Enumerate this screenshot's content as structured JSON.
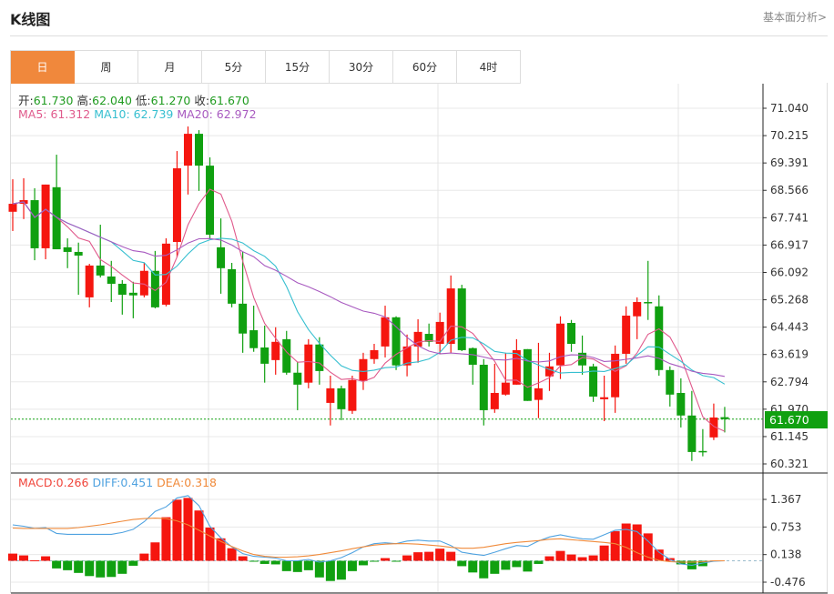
{
  "header": {
    "title": "K线图",
    "fundamental_link": "基本面分析>"
  },
  "tabs": [
    {
      "label": "日",
      "active": true
    },
    {
      "label": "周"
    },
    {
      "label": "月"
    },
    {
      "label": "5分"
    },
    {
      "label": "15分"
    },
    {
      "label": "30分"
    },
    {
      "label": "60分"
    },
    {
      "label": "4时"
    }
  ],
  "ohlc_info": {
    "open_label": "开:",
    "open": "61.730",
    "high_label": "高:",
    "high": "62.040",
    "low_label": "低:",
    "low": "61.270",
    "close_label": "收:",
    "close": "61.670"
  },
  "ma_info": {
    "ma5": "MA5: 61.312",
    "ma10": "MA10: 62.739",
    "ma20": "MA20: 62.972"
  },
  "macd_info": {
    "macd": "MACD:0.266",
    "diff": "DIFF:0.451",
    "dea": "DEA:0.318"
  },
  "last_price_label": "61.670",
  "colors": {
    "up": "#f5160f",
    "down": "#10a010",
    "ma5": "#e05a8c",
    "ma10": "#36bfd0",
    "ma20": "#a85ac0",
    "diff": "#4fa2e0",
    "dea": "#f08a3a",
    "active_tab": "#f0883c"
  },
  "chart_data": [
    {
      "type": "candlestick",
      "ylim": [
        60.321,
        71.04
      ],
      "y_ticks": [
        "71.040",
        "70.215",
        "69.391",
        "68.566",
        "67.741",
        "66.917",
        "66.092",
        "65.268",
        "64.443",
        "63.619",
        "62.794",
        "61.970",
        "61.145",
        "60.321"
      ],
      "last_price": 61.67,
      "ohlc": [
        [
          67.92,
          68.16,
          68.9,
          67.34
        ],
        [
          68.16,
          68.27,
          68.93,
          67.7
        ],
        [
          68.27,
          66.82,
          68.63,
          66.46
        ],
        [
          66.82,
          68.74,
          68.74,
          66.49
        ],
        [
          68.66,
          66.79,
          69.64,
          66.79
        ],
        [
          66.85,
          66.71,
          67.12,
          66.22
        ],
        [
          66.71,
          66.6,
          66.99,
          65.42
        ],
        [
          65.34,
          66.3,
          66.35,
          65.04
        ],
        [
          66.3,
          66.0,
          67.53,
          65.94
        ],
        [
          65.97,
          65.75,
          66.44,
          65.2
        ],
        [
          65.75,
          65.42,
          65.86,
          64.82
        ],
        [
          65.48,
          65.4,
          65.81,
          64.71
        ],
        [
          65.4,
          66.14,
          66.38,
          65.34
        ],
        [
          66.14,
          65.04,
          66.74,
          65.01
        ],
        [
          65.12,
          66.96,
          67.12,
          65.07
        ],
        [
          67.01,
          69.23,
          69.75,
          66.55
        ],
        [
          69.31,
          70.27,
          70.49,
          68.44
        ],
        [
          70.27,
          69.31,
          70.38,
          68.55
        ],
        [
          69.31,
          67.23,
          69.56,
          67.09
        ],
        [
          66.85,
          66.22,
          67.72,
          65.45
        ],
        [
          66.19,
          65.15,
          66.38,
          65.04
        ],
        [
          65.15,
          64.25,
          66.71,
          63.67
        ],
        [
          64.35,
          63.81,
          65.09,
          63.7
        ],
        [
          63.83,
          63.34,
          64.49,
          62.77
        ],
        [
          63.45,
          64.0,
          64.44,
          63.01
        ],
        [
          64.08,
          63.07,
          64.33,
          63.01
        ],
        [
          63.07,
          62.71,
          63.4,
          61.94
        ],
        [
          62.77,
          63.92,
          64.08,
          62.6
        ],
        [
          63.92,
          63.12,
          64.14,
          62.71
        ],
        [
          62.16,
          62.6,
          62.98,
          61.48
        ],
        [
          62.6,
          61.97,
          62.68,
          61.64
        ],
        [
          61.92,
          62.85,
          62.98,
          61.83
        ],
        [
          62.82,
          63.48,
          63.67,
          62.55
        ],
        [
          63.48,
          63.75,
          63.94,
          63.34
        ],
        [
          63.86,
          64.74,
          65.09,
          63.53
        ],
        [
          64.74,
          63.29,
          64.77,
          63.15
        ],
        [
          63.29,
          63.86,
          64.22,
          62.96
        ],
        [
          63.86,
          64.3,
          64.68,
          63.37
        ],
        [
          64.24,
          64.0,
          64.55,
          63.86
        ],
        [
          63.94,
          64.6,
          64.88,
          63.64
        ],
        [
          63.94,
          65.61,
          66.0,
          63.67
        ],
        [
          65.61,
          63.75,
          65.72,
          63.72
        ],
        [
          63.81,
          63.31,
          63.83,
          62.71
        ],
        [
          63.31,
          61.94,
          63.48,
          61.48
        ],
        [
          61.97,
          62.46,
          63.34,
          61.86
        ],
        [
          62.41,
          62.77,
          63.67,
          62.38
        ],
        [
          62.71,
          63.75,
          64.08,
          62.71
        ],
        [
          63.78,
          62.22,
          63.78,
          62.22
        ],
        [
          62.25,
          62.6,
          63.97,
          61.7
        ],
        [
          62.96,
          63.26,
          63.67,
          62.52
        ],
        [
          63.29,
          64.55,
          64.77,
          62.88
        ],
        [
          64.57,
          63.94,
          64.66,
          63.7
        ],
        [
          63.67,
          63.29,
          64.19,
          63.01
        ],
        [
          63.26,
          62.35,
          63.34,
          62.19
        ],
        [
          62.27,
          62.33,
          62.98,
          61.61
        ],
        [
          62.33,
          63.64,
          63.89,
          61.86
        ],
        [
          63.64,
          64.79,
          65.07,
          63.34
        ],
        [
          64.77,
          65.2,
          65.34,
          64.08
        ],
        [
          65.2,
          65.18,
          66.44,
          64.66
        ],
        [
          65.07,
          63.15,
          65.4,
          62.98
        ],
        [
          63.15,
          62.41,
          63.26,
          62.05
        ],
        [
          62.46,
          61.78,
          62.9,
          61.42
        ],
        [
          61.78,
          60.68,
          62.52,
          60.41
        ],
        [
          60.71,
          60.68,
          61.37,
          60.55
        ],
        [
          61.12,
          61.72,
          62.14,
          61.04
        ],
        [
          61.73,
          61.67,
          62.04,
          61.27
        ]
      ]
    },
    {
      "type": "bar+line",
      "ylim": [
        -0.476,
        1.367
      ],
      "y_ticks": [
        "1.367",
        "0.753",
        "0.138",
        "-0.476"
      ],
      "macd_hist": [
        0.16,
        0.12,
        0.01,
        0.1,
        -0.17,
        -0.21,
        -0.27,
        -0.34,
        -0.37,
        -0.36,
        -0.29,
        -0.11,
        0.16,
        0.41,
        0.97,
        1.36,
        1.4,
        1.12,
        0.74,
        0.5,
        0.28,
        0.1,
        -0.01,
        -0.07,
        -0.08,
        -0.23,
        -0.25,
        -0.21,
        -0.37,
        -0.45,
        -0.42,
        -0.23,
        -0.1,
        -0.01,
        0.06,
        -0.02,
        0.12,
        0.19,
        0.2,
        0.27,
        0.2,
        -0.12,
        -0.26,
        -0.39,
        -0.29,
        -0.2,
        -0.14,
        -0.24,
        -0.07,
        0.1,
        0.22,
        0.14,
        0.08,
        0.12,
        0.34,
        0.66,
        0.83,
        0.81,
        0.61,
        0.25,
        0.06,
        -0.08,
        -0.19,
        -0.12,
        0,
        0
      ],
      "diff": [
        0.8,
        0.77,
        0.72,
        0.74,
        0.61,
        0.59,
        0.59,
        0.59,
        0.59,
        0.59,
        0.63,
        0.7,
        0.87,
        1.1,
        1.2,
        1.4,
        1.45,
        1.23,
        0.77,
        0.51,
        0.31,
        0.16,
        0.1,
        0.08,
        0.06,
        0.0,
        0.0,
        0.03,
        -0.03,
        0.0,
        0.07,
        0.18,
        0.31,
        0.38,
        0.4,
        0.38,
        0.44,
        0.46,
        0.44,
        0.44,
        0.34,
        0.19,
        0.15,
        0.12,
        0.19,
        0.27,
        0.34,
        0.32,
        0.44,
        0.53,
        0.58,
        0.53,
        0.49,
        0.48,
        0.58,
        0.68,
        0.7,
        0.65,
        0.44,
        0.19,
        0.03,
        -0.07,
        -0.1,
        -0.05,
        -0.01,
        0.0
      ],
      "dea": [
        0.73,
        0.72,
        0.72,
        0.72,
        0.72,
        0.72,
        0.74,
        0.77,
        0.8,
        0.84,
        0.88,
        0.92,
        0.94,
        0.95,
        0.94,
        0.89,
        0.8,
        0.68,
        0.55,
        0.43,
        0.32,
        0.22,
        0.14,
        0.1,
        0.08,
        0.08,
        0.09,
        0.11,
        0.14,
        0.18,
        0.22,
        0.27,
        0.31,
        0.35,
        0.37,
        0.38,
        0.38,
        0.37,
        0.35,
        0.33,
        0.3,
        0.28,
        0.28,
        0.3,
        0.34,
        0.38,
        0.41,
        0.43,
        0.45,
        0.48,
        0.49,
        0.47,
        0.45,
        0.43,
        0.41,
        0.38,
        0.3,
        0.18,
        0.08,
        0.01,
        -0.02,
        -0.03,
        -0.03,
        -0.02,
        0.0,
        0.0
      ]
    }
  ]
}
